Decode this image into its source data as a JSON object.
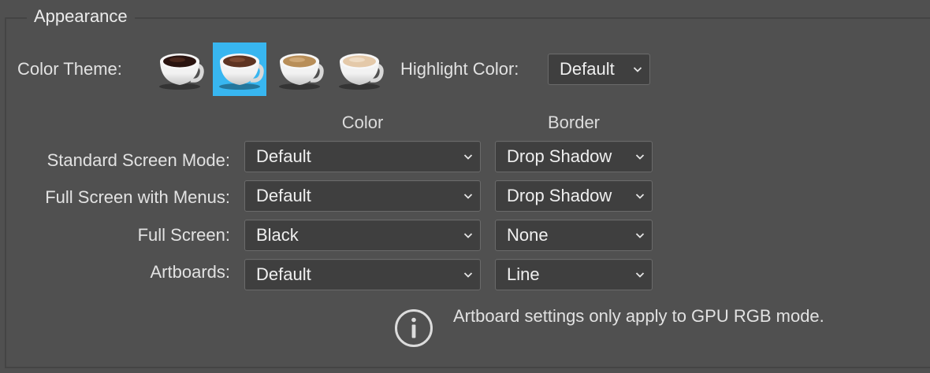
{
  "group": {
    "title": "Appearance"
  },
  "theme": {
    "label": "Color Theme:",
    "icons": [
      "coffee-cup-darkest-icon",
      "coffee-cup-dark-icon",
      "coffee-cup-light-icon",
      "coffee-cup-lightest-icon"
    ],
    "selected_index": 1,
    "selection_color": "#38b6f0"
  },
  "highlight": {
    "label": "Highlight Color:",
    "value": "Default"
  },
  "columns": {
    "color": "Color",
    "border": "Border"
  },
  "rows": [
    {
      "label": "Standard Screen Mode:",
      "color": "Default",
      "border": "Drop Shadow"
    },
    {
      "label": "Full Screen with Menus:",
      "color": "Default",
      "border": "Drop Shadow"
    },
    {
      "label": "Full Screen:",
      "color": "Black",
      "border": "None"
    },
    {
      "label": "Artboards:",
      "color": "Default",
      "border": "Line"
    }
  ],
  "note": {
    "icon": "info-icon",
    "text": "Artboard settings only apply to GPU RGB mode."
  }
}
